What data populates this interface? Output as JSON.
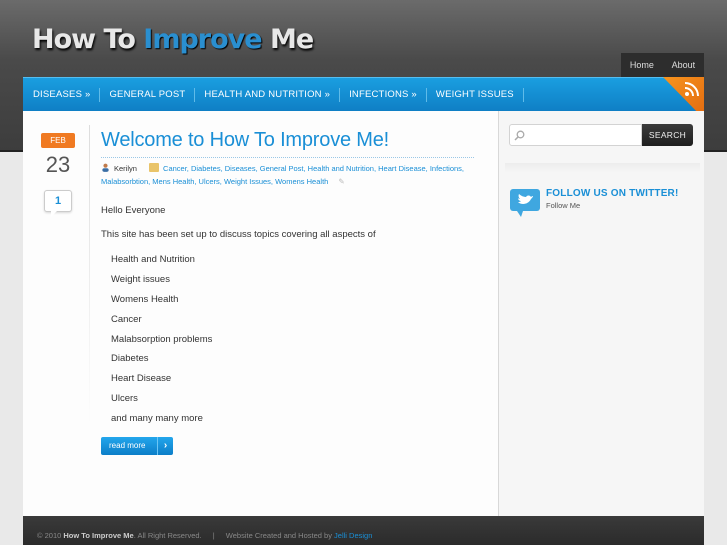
{
  "site": {
    "logo_part1": "How To",
    "logo_part2": "Improve",
    "logo_part3": "Me"
  },
  "top_links": [
    "Home",
    "About"
  ],
  "nav": {
    "items": [
      "DISEASES »",
      "GENERAL POST",
      "HEALTH AND NUTRITION »",
      "INFECTIONS »",
      "WEIGHT ISSUES"
    ]
  },
  "post": {
    "month": "FEB",
    "day": "23",
    "comment_count": "1",
    "title": "Welcome to How To Improve Me!",
    "author": "Kerilyn",
    "categories": "Cancer, Diabetes, Diseases, General Post, Health and Nutrition, Heart Disease, Infections, Malabsorbtion, Mens Health, Ulcers, Weight Issues, Womens Health",
    "greeting": "Hello Everyone",
    "intro": "This site has been set up to discuss topics covering all aspects of",
    "topics": [
      "Health and Nutrition",
      "Weight issues",
      "Womens Health",
      "Cancer",
      "Malabsorption problems",
      "Diabetes",
      "Heart Disease",
      "Ulcers",
      "and many many more"
    ],
    "read_more": "read more"
  },
  "sidebar": {
    "search_placeholder": "",
    "search_button": "SEARCH",
    "twitter_title": "FOLLOW US ON TWITTER!",
    "twitter_sub": "Follow Me"
  },
  "footer": {
    "copyright": "© 2010",
    "site_name": "How To Improve Me",
    "rights": ". All Right Reserved.",
    "pipe": "|",
    "credit": "Website Created and Hosted by",
    "credit_link": "Jelli Design"
  },
  "colors": {
    "accent": "#1a8fd6",
    "orange": "#f07a22"
  }
}
